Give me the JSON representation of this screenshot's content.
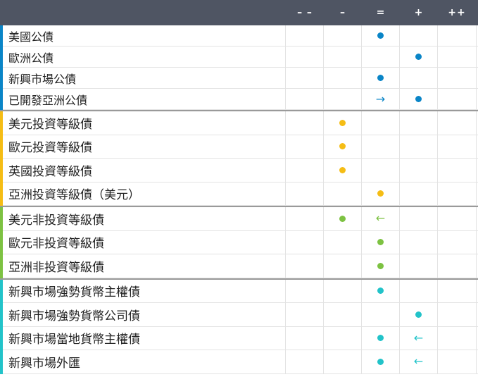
{
  "columns": [
    "– –",
    "–",
    "=",
    "+",
    "++"
  ],
  "colors": {
    "header_bg": "#4f5563",
    "blue": "#0a85c7",
    "yellow": "#f5bd15",
    "green": "#7dc242",
    "teal": "#22c3c9"
  },
  "groups": [
    {
      "color": "#0a85c7",
      "rows": [
        {
          "label": "美國公債",
          "marks": [
            null,
            null,
            "dot",
            null,
            null
          ]
        },
        {
          "label": "歐洲公債",
          "marks": [
            null,
            null,
            null,
            "dot",
            null
          ]
        },
        {
          "label": "新興市場公債",
          "marks": [
            null,
            null,
            "dot",
            null,
            null
          ]
        },
        {
          "label": "已開發亞洲公債",
          "marks": [
            null,
            null,
            "arrow-right",
            "dot",
            null
          ]
        }
      ]
    },
    {
      "color": "#f5bd15",
      "rows": [
        {
          "label": "美元投資等級債",
          "marks": [
            null,
            "dot",
            null,
            null,
            null
          ]
        },
        {
          "label": "歐元投資等級債",
          "marks": [
            null,
            "dot",
            null,
            null,
            null
          ]
        },
        {
          "label": "英國投資等級債",
          "marks": [
            null,
            "dot",
            null,
            null,
            null
          ]
        },
        {
          "label": "亞洲投資等級債（美元）",
          "marks": [
            null,
            null,
            "dot",
            null,
            null
          ]
        }
      ]
    },
    {
      "color": "#7dc242",
      "rows": [
        {
          "label": "美元非投資等級債",
          "marks": [
            null,
            "dot",
            "arrow-left",
            null,
            null
          ]
        },
        {
          "label": "歐元非投資等級債",
          "marks": [
            null,
            null,
            "dot",
            null,
            null
          ]
        },
        {
          "label": "亞洲非投資等級債",
          "marks": [
            null,
            null,
            "dot",
            null,
            null
          ]
        }
      ]
    },
    {
      "color": "#22c3c9",
      "rows": [
        {
          "label": "新興市場強勢貨幣主權債",
          "marks": [
            null,
            null,
            "dot",
            null,
            null
          ]
        },
        {
          "label": "新興市場強勢貨幣公司債",
          "marks": [
            null,
            null,
            null,
            "dot",
            null
          ]
        },
        {
          "label": "新興市場當地貨幣主權債",
          "marks": [
            null,
            null,
            "dot",
            "arrow-left",
            null
          ]
        },
        {
          "label": "新興市場外匯",
          "marks": [
            null,
            null,
            "dot",
            "arrow-left",
            null
          ]
        }
      ]
    }
  ]
}
